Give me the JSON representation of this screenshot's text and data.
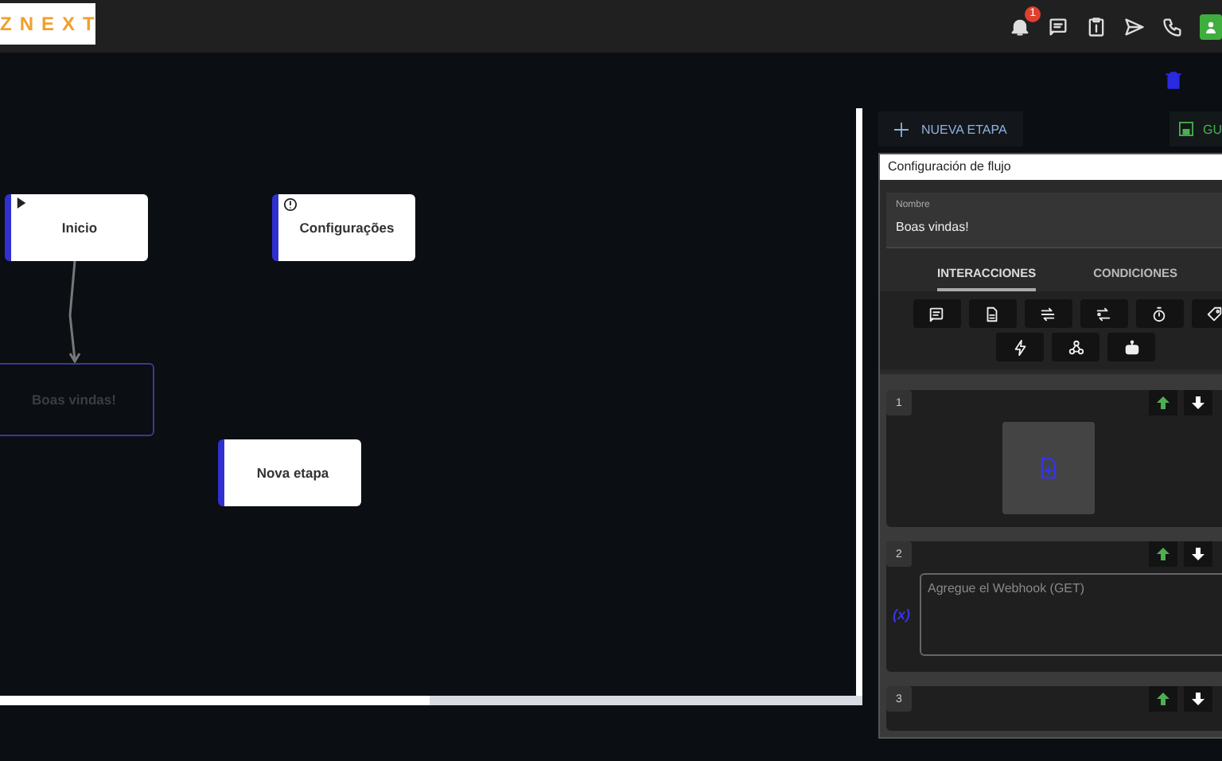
{
  "header": {
    "logo": "ZNEXT",
    "notifications": {
      "badge": "1"
    }
  },
  "toolbar": {
    "new_step": "NUEVA ETAPA",
    "save": "GU"
  },
  "canvas": {
    "nodes": [
      {
        "label": "Inicio",
        "kind": "start",
        "selected": false
      },
      {
        "label": "Configurações",
        "kind": "info",
        "selected": false
      },
      {
        "label": "Boas vindas!",
        "kind": "step",
        "selected": true
      },
      {
        "label": "Nova etapa",
        "kind": "step",
        "selected": false
      }
    ]
  },
  "panel": {
    "title": "Configuración de flujo",
    "name_field": {
      "label": "Nombre",
      "value": "Boas vindas!"
    },
    "tabs": [
      {
        "label": "INTERACCIONES",
        "selected": true
      },
      {
        "label": "CONDICIONES",
        "selected": false
      }
    ],
    "interactions": [
      {
        "number": "1",
        "kind": "media"
      },
      {
        "number": "2",
        "kind": "webhook",
        "variable": "(x)",
        "placeholder": "Agregue el Webhook (GET)"
      },
      {
        "number": "3",
        "kind": "empty"
      }
    ]
  }
}
